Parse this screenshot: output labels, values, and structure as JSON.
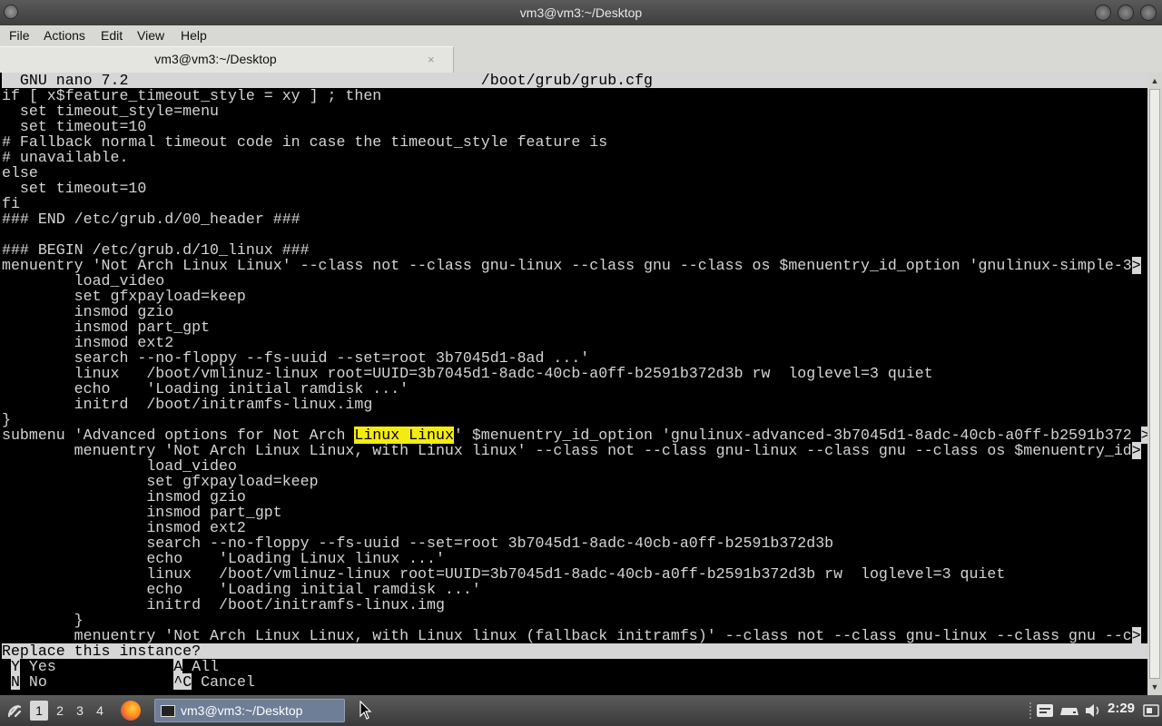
{
  "window": {
    "title": "vm3@vm3:~/Desktop"
  },
  "menu": {
    "file": "File",
    "actions": "Actions",
    "edit": "Edit",
    "view": "View",
    "help": "Help"
  },
  "tab": {
    "label": "vm3@vm3:~/Desktop",
    "close": "×"
  },
  "nano": {
    "version": "GNU nano 7.2",
    "filename": "/boot/grub/grub.cfg",
    "lines": [
      "if [ x$feature_timeout_style = xy ] ; then",
      "  set timeout_style=menu",
      "  set timeout=10",
      "# Fallback normal timeout code in case the timeout_style feature is",
      "# unavailable.",
      "else",
      "  set timeout=10",
      "fi",
      "### END /etc/grub.d/00_header ###",
      "",
      "### BEGIN /etc/grub.d/10_linux ###",
      "menuentry 'Not Arch Linux Linux' --class not --class gnu-linux --class gnu --class os $menuentry_id_option 'gnulinux-simple-3",
      "        load_video",
      "        set gfxpayload=keep",
      "        insmod gzio",
      "        insmod part_gpt",
      "        insmod ext2",
      "        search --no-floppy --fs-uuid --set=root 3b7045d1-8ad ...'",
      "        linux   /boot/vmlinuz-linux root=UUID=3b7045d1-8adc-40cb-a0ff-b2591b372d3b rw  loglevel=3 quiet",
      "        echo    'Loading initial ramdisk ...'",
      "        initrd  /boot/initramfs-linux.img",
      "}"
    ],
    "submenu_before": "submenu 'Advanced options for Not Arch ",
    "submenu_match": "Linux Linux",
    "submenu_after": "' $menuentry_id_option 'gnulinux-advanced-3b7045d1-8adc-40cb-a0ff-b2591b372 ",
    "lines2": [
      "        menuentry 'Not Arch Linux Linux, with Linux linux' --class not --class gnu-linux --class gnu --class os $menuentry_id",
      "                load_video",
      "                set gfxpayload=keep",
      "                insmod gzio",
      "                insmod part_gpt",
      "                insmod ext2",
      "                search --no-floppy --fs-uuid --set=root 3b7045d1-8adc-40cb-a0ff-b2591b372d3b",
      "                echo    'Loading Linux linux ...'",
      "                linux   /boot/vmlinuz-linux root=UUID=3b7045d1-8adc-40cb-a0ff-b2591b372d3b rw  loglevel=3 quiet",
      "                echo    'Loading initial ramdisk ...'",
      "                initrd  /boot/initramfs-linux.img",
      "        }",
      "        menuentry 'Not Arch Linux Linux, with Linux linux (fallback initramfs)' --class not --class gnu-linux --class gnu --c"
    ],
    "overflow_marker": ">",
    "prompt": "Replace this instance?",
    "shortcuts": {
      "yes_key": "Y",
      "yes_label": "Yes",
      "all_key": "A",
      "all_label": "All",
      "no_key": "N",
      "no_label": "No",
      "cancel_key": "^C",
      "cancel_label": "Cancel"
    }
  },
  "taskbar": {
    "workspaces": [
      "1",
      "2",
      "3",
      "4"
    ],
    "task_label": "vm3@vm3:~/Desktop",
    "clock": "2:29"
  },
  "colors": {
    "highlight": "#f4ec10",
    "terminal_bg": "#000000",
    "terminal_fg": "#d4d4d4"
  }
}
